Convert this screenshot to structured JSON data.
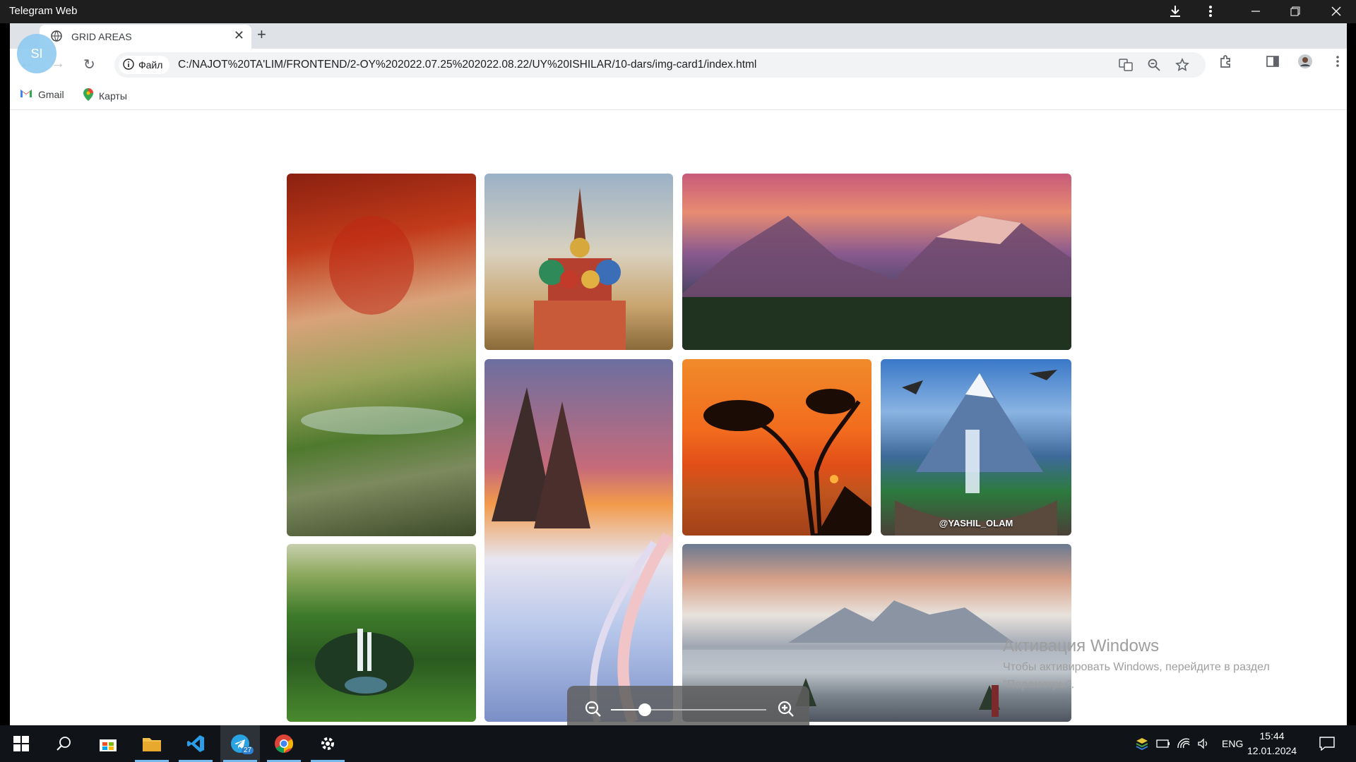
{
  "telegram": {
    "title": "Telegram Web"
  },
  "browser": {
    "profile_initials": "SI",
    "tab": {
      "title": "GRID AREAS"
    },
    "address": {
      "scheme_label": "Файл",
      "url": "C:/NAJOT%20TA'LIM/FRONTEND/2-OY%202022.07.25%202022.08.22/UY%20ISHILAR/10-dars/img-card1/index.html"
    },
    "bookmarks": [
      {
        "label": "Gmail",
        "icon": "gmail-icon"
      },
      {
        "label": "Карты",
        "icon": "maps-pin-icon"
      }
    ]
  },
  "gallery": {
    "images": [
      {
        "name": "autumn-forest-stream",
        "caption": ""
      },
      {
        "name": "st-basils-cathedral",
        "caption": ""
      },
      {
        "name": "sunset-mountains",
        "caption": ""
      },
      {
        "name": "winter-sunset-trail",
        "caption": ""
      },
      {
        "name": "orange-sunset-tree",
        "caption": ""
      },
      {
        "name": "mountain-waterfall-hands",
        "caption": "@YASHIL_OLAM"
      },
      {
        "name": "aerial-waterfall-jungle",
        "caption": ""
      },
      {
        "name": "dolomites-valley",
        "caption": ""
      }
    ]
  },
  "zoom": {
    "level": 0.22
  },
  "watermark": {
    "title": "Активация Windows",
    "line1": "Чтобы активировать Windows, перейдите в раздел",
    "line2": "\"Параметры\"."
  },
  "taskbar": {
    "apps": [
      "windows-start-icon",
      "search-icon",
      "store-icon",
      "file-explorer-icon",
      "vscode-icon",
      "telegram-icon",
      "chrome-icon",
      "settings-icon"
    ],
    "telegram_badge": "27",
    "language": "ENG",
    "time": "15:44",
    "date": "12.01.2024"
  }
}
